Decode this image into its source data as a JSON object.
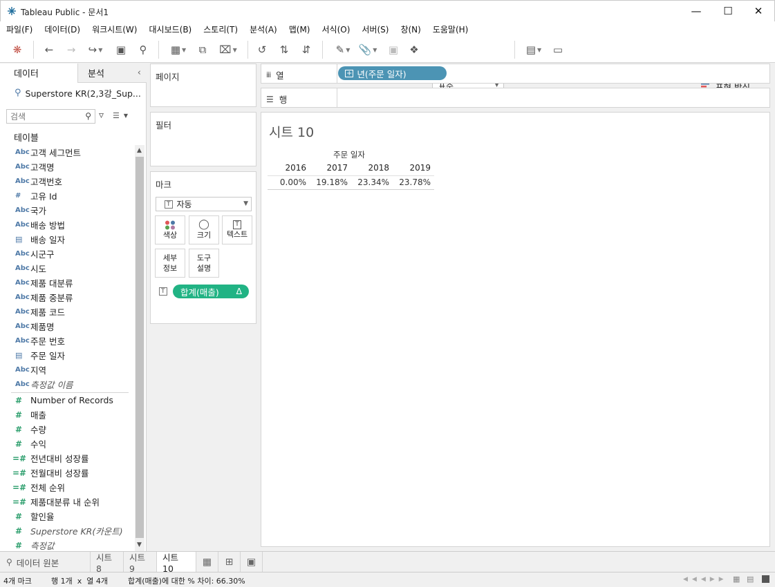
{
  "window": {
    "title": "Tableau Public - 문서1"
  },
  "menu": [
    "파일(F)",
    "데이터(D)",
    "워크시트(W)",
    "대시보드(B)",
    "스토리(T)",
    "분석(A)",
    "맵(M)",
    "서식(O)",
    "서버(S)",
    "창(N)",
    "도움말(H)"
  ],
  "toolbar": {
    "fit_select": "표준",
    "show_me": "표현 방식"
  },
  "left_panel": {
    "tab_data": "데이터",
    "tab_analysis": "분석",
    "datasource": "Superstore KR(2,3강_Sup...",
    "search_placeholder": "검색",
    "tables_header": "테이블",
    "dimensions": [
      {
        "icon": "Abc",
        "label": "고객 세그먼트"
      },
      {
        "icon": "Abc",
        "label": "고객명"
      },
      {
        "icon": "Abc",
        "label": "고객번호"
      },
      {
        "icon": "#",
        "label": "고유 Id"
      },
      {
        "icon": "Abc",
        "label": "국가"
      },
      {
        "icon": "Abc",
        "label": "배송 방법"
      },
      {
        "icon": "date",
        "label": "배송 일자"
      },
      {
        "icon": "Abc",
        "label": "시군구"
      },
      {
        "icon": "Abc",
        "label": "시도"
      },
      {
        "icon": "Abc",
        "label": "제품 대분류"
      },
      {
        "icon": "Abc",
        "label": "제품 중분류"
      },
      {
        "icon": "Abc",
        "label": "제품 코드"
      },
      {
        "icon": "Abc",
        "label": "제품명"
      },
      {
        "icon": "Abc",
        "label": "주문 번호"
      },
      {
        "icon": "date",
        "label": "주문 일자"
      },
      {
        "icon": "Abc",
        "label": "지역"
      },
      {
        "icon": "Abc",
        "label": "측정값 이름",
        "italic": true
      }
    ],
    "measures": [
      {
        "icon": "#",
        "label": "Number of Records"
      },
      {
        "icon": "#",
        "label": "매출"
      },
      {
        "icon": "#",
        "label": "수량"
      },
      {
        "icon": "#",
        "label": "수익"
      },
      {
        "icon": "=#",
        "label": "전년대비 성장률"
      },
      {
        "icon": "=#",
        "label": "전월대비 성장률"
      },
      {
        "icon": "=#",
        "label": "전체 순위"
      },
      {
        "icon": "=#",
        "label": "제품대분류 내 순위"
      },
      {
        "icon": "#",
        "label": "할인율"
      },
      {
        "icon": "#",
        "label": "Superstore KR(카운트)",
        "italic": true
      },
      {
        "icon": "#",
        "label": "측정값",
        "italic": true
      }
    ]
  },
  "cards": {
    "pages": "페이지",
    "filters": "필터",
    "marks": "마크",
    "mark_type": "자동",
    "mark_buttons": {
      "color": "색상",
      "size": "크기",
      "text": "텍스트",
      "detail": "세부\n정보",
      "tooltip": "도구\n설명"
    },
    "mark_pill": "합계(매출)",
    "mark_pill_delta": "Δ"
  },
  "shelves": {
    "columns_label": "열",
    "rows_label": "행",
    "columns_pill": "년(주문 일자)"
  },
  "view": {
    "sheet_title": "시트 10",
    "header_title": "주문 일자",
    "table": {
      "columns": [
        "2016",
        "2017",
        "2018",
        "2019"
      ],
      "values": [
        "0.00%",
        "19.18%",
        "23.34%",
        "23.78%"
      ]
    }
  },
  "sheet_tabs": {
    "data_source": "데이터 원본",
    "tabs": [
      "시트 8",
      "시트 9",
      "시트 10"
    ],
    "active": "시트 10"
  },
  "status": {
    "marks": "4개 마크",
    "rows_cols": "행 1개  x  열 4개",
    "summary": "합계(매출)에 대한 % 차이: 66.30%"
  },
  "colors": {
    "pill_blue": "#4c94b4",
    "pill_green": "#21b384"
  }
}
